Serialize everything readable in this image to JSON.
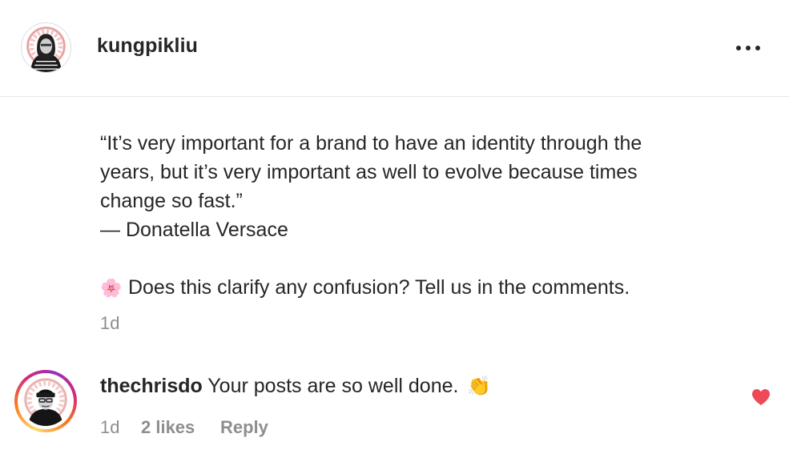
{
  "post": {
    "username": "kungpikliu",
    "avatar_icon": "profile-photo-woman-hijab",
    "more_icon": "more-options-icon",
    "caption": {
      "quote_line1": "“It’s very important for a brand to have an identity through the",
      "quote_line2": "years, but it’s very important as well to evolve because times",
      "quote_line3": "change so fast.”",
      "attribution": "— Donatella Versace",
      "emoji": "🌸",
      "prompt": "Does this clarify any confusion? Tell us in the comments."
    },
    "time": "1d"
  },
  "comments": [
    {
      "username": "thechrisdo",
      "text": "Your posts are so well done.",
      "emoji": "👏",
      "time": "1d",
      "likes": "2 likes",
      "reply_label": "Reply",
      "liked": true,
      "heart_color": "#ed4956",
      "avatar_icon": "profile-photo-man-beanie"
    }
  ],
  "colors": {
    "text": "#262626",
    "secondary": "#8e8e8e",
    "divider": "#e6e6e6",
    "like": "#ed4956"
  }
}
